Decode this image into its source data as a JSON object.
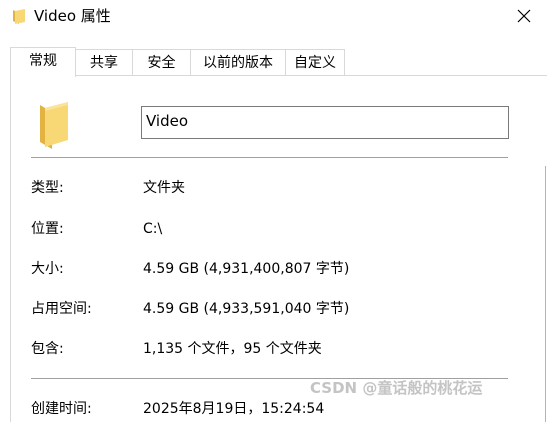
{
  "window": {
    "title": "Video 属性"
  },
  "tabs": [
    {
      "label": "常规",
      "active": true
    },
    {
      "label": "共享",
      "active": false
    },
    {
      "label": "安全",
      "active": false
    },
    {
      "label": "以前的版本",
      "active": false
    },
    {
      "label": "自定义",
      "active": false
    }
  ],
  "general": {
    "name_value": "Video",
    "rows": {
      "type": {
        "label": "类型:",
        "value": "文件夹"
      },
      "location": {
        "label": "位置:",
        "value": "C:\\"
      },
      "size": {
        "label": "大小:",
        "value": "4.59 GB (4,931,400,807 字节)"
      },
      "size_on_disk": {
        "label": "占用空间:",
        "value": "4.59 GB (4,933,591,040 字节)"
      },
      "contains": {
        "label": "包含:",
        "value": "1,135 个文件，95 个文件夹"
      },
      "created": {
        "label": "创建时间:",
        "value": "2025年8月19日，15:24:54"
      }
    }
  },
  "watermark": "CSDN @童话般的桃花运",
  "icons": {
    "title": "folder-icon",
    "close": "close-icon",
    "large": "folder-icon"
  },
  "colors": {
    "folder_yellow": "#f8d775",
    "folder_dark": "#e3b341",
    "border": "#d9d9d9",
    "divider": "#a0a0a0"
  }
}
